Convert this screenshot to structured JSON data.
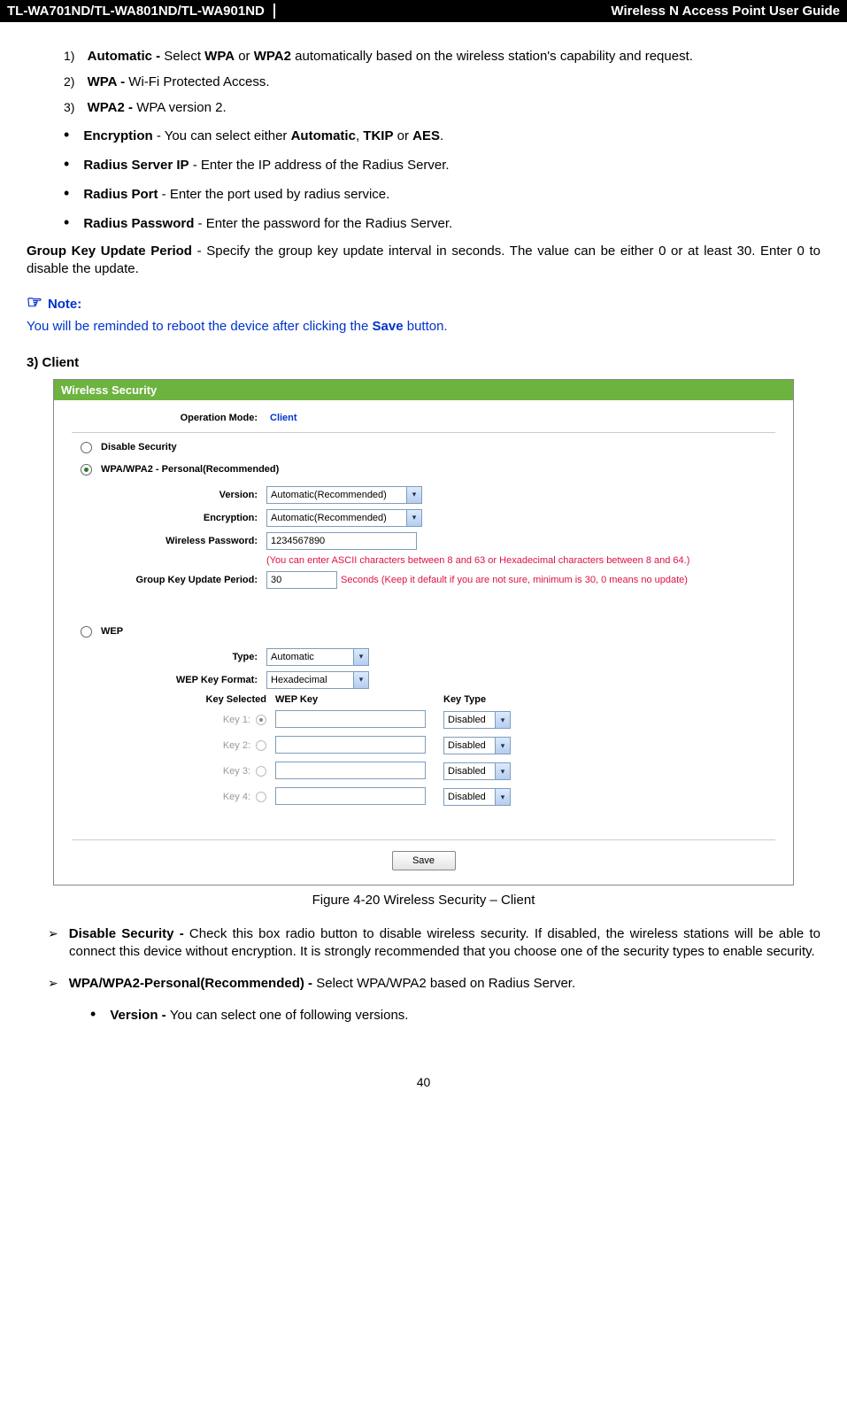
{
  "header": {
    "model": "TL-WA701ND/TL-WA801ND/TL-WA901ND",
    "guide": "Wireless N Access Point User Guide"
  },
  "numlist": {
    "item1_num": "1)",
    "item1_bold": "Automatic -",
    "item1_rest": " Select ",
    "item1_b2": "WPA",
    "item1_mid": " or ",
    "item1_b3": "WPA2",
    "item1_end": " automatically based on the wireless station's capability and request.",
    "item2_num": "2)",
    "item2_bold": "WPA - ",
    "item2_rest": "Wi-Fi Protected Access.",
    "item3_num": "3)",
    "item3_bold": "WPA2 - ",
    "item3_rest": "WPA version 2."
  },
  "bullets": {
    "b1_bold": "Encryption",
    "b1_rest": " - You can select either ",
    "b1_b2": "Automatic",
    "b1_mid": ", ",
    "b1_b3": "TKIP",
    "b1_mid2": " or ",
    "b1_b4": "AES",
    "b1_end": ".",
    "b2_bold": "Radius Server IP",
    "b2_rest": " - Enter the IP address of the Radius Server.",
    "b3_bold": "Radius Port",
    "b3_rest": " - Enter the port used by radius service.",
    "b4_bold": "Radius Password",
    "b4_rest": " - Enter the password for the Radius Server."
  },
  "group_key": {
    "bold": "Group Key Update Period",
    "rest": " - Specify the group key update interval in seconds. The value can be either 0 or at least 30. Enter 0 to disable the update."
  },
  "note": {
    "label": "Note:",
    "body_pre": "You will be reminded to reboot the device after clicking the ",
    "body_bold": "Save",
    "body_post": " button."
  },
  "section3": "3)   Client",
  "screenshot": {
    "title": "Wireless Security",
    "op_mode_lbl": "Operation Mode:",
    "op_mode_val": "Client",
    "disable_sec": "Disable Security",
    "wpa_personal": "WPA/WPA2 - Personal(Recommended)",
    "version_lbl": "Version:",
    "version_val": "Automatic(Recommended)",
    "encryption_lbl": "Encryption:",
    "encryption_val": "Automatic(Recommended)",
    "wpass_lbl": "Wireless Password:",
    "wpass_val": "1234567890",
    "wpass_hint": "(You can enter ASCII characters between 8 and 63 or Hexadecimal characters between 8 and 64.)",
    "gkup_lbl": "Group Key Update Period:",
    "gkup_val": "30",
    "gkup_hint": "Seconds (Keep it default if you are not sure, minimum is 30, 0 means no update)",
    "wep": "WEP",
    "type_lbl": "Type:",
    "type_val": "Automatic",
    "wepfmt_lbl": "WEP Key Format:",
    "wepfmt_val": "Hexadecimal",
    "key_sel": "Key Selected",
    "wep_key": "WEP Key",
    "key_type": "Key Type",
    "key1": "Key 1:",
    "key2": "Key 2:",
    "key3": "Key 3:",
    "key4": "Key 4:",
    "disabled": "Disabled",
    "save": "Save"
  },
  "fig_caption": "Figure 4-20 Wireless Security – Client",
  "arrowlist": {
    "a1_bold": "Disable Security - ",
    "a1_rest": "Check this box radio button to disable wireless security. If disabled, the wireless stations will be able to connect this device without encryption. It is strongly recommended that you choose one of the security types to enable security.",
    "a2_bold": "WPA/WPA2-Personal(Recommended) - ",
    "a2_rest": "Select WPA/WPA2 based on Radius Server.",
    "sub_bold": "Version - ",
    "sub_rest": "You can select one of following versions."
  },
  "page_num": "40"
}
